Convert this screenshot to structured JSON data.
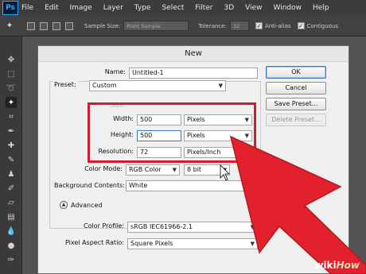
{
  "app": {
    "logo": "Ps",
    "menu": [
      "File",
      "Edit",
      "Image",
      "Layer",
      "Type",
      "Select",
      "Filter",
      "3D",
      "View",
      "Window",
      "Help"
    ]
  },
  "options_bar": {
    "sample_size_label": "Sample Size:",
    "sample_size_value": "Point Sample",
    "tolerance_label": "Tolerance:",
    "tolerance_value": "32",
    "anti_alias_label": "Anti-alias",
    "contiguous_label": "Contiguous"
  },
  "dialog": {
    "title": "New",
    "name_label": "Name:",
    "name_value": "Untitled-1",
    "preset_label": "Preset:",
    "preset_value": "Custom",
    "size_label": "Size:",
    "width_label": "Width:",
    "width_value": "500",
    "width_unit": "Pixels",
    "height_label": "Height:",
    "height_value": "500",
    "height_unit": "Pixels",
    "resolution_label": "Resolution:",
    "resolution_value": "72",
    "resolution_unit": "Pixels/Inch",
    "color_mode_label": "Color Mode:",
    "color_mode_value": "RGB Color",
    "bit_depth_value": "8 bit",
    "background_label": "Background Contents:",
    "background_value": "White",
    "advanced_label": "Advanced",
    "color_profile_label": "Color Profile:",
    "color_profile_value": "sRGB IEC61966-2.1",
    "pixel_aspect_label": "Pixel Aspect Ratio:",
    "pixel_aspect_value": "Square Pixels",
    "buttons": {
      "ok": "OK",
      "cancel": "Cancel",
      "save_preset": "Save Preset...",
      "delete_preset": "Delete Preset..."
    }
  },
  "colors": {
    "highlight": "#d8192a",
    "arrow": "#e2212d"
  },
  "watermark": {
    "wiki": "wiki",
    "how": "How"
  }
}
